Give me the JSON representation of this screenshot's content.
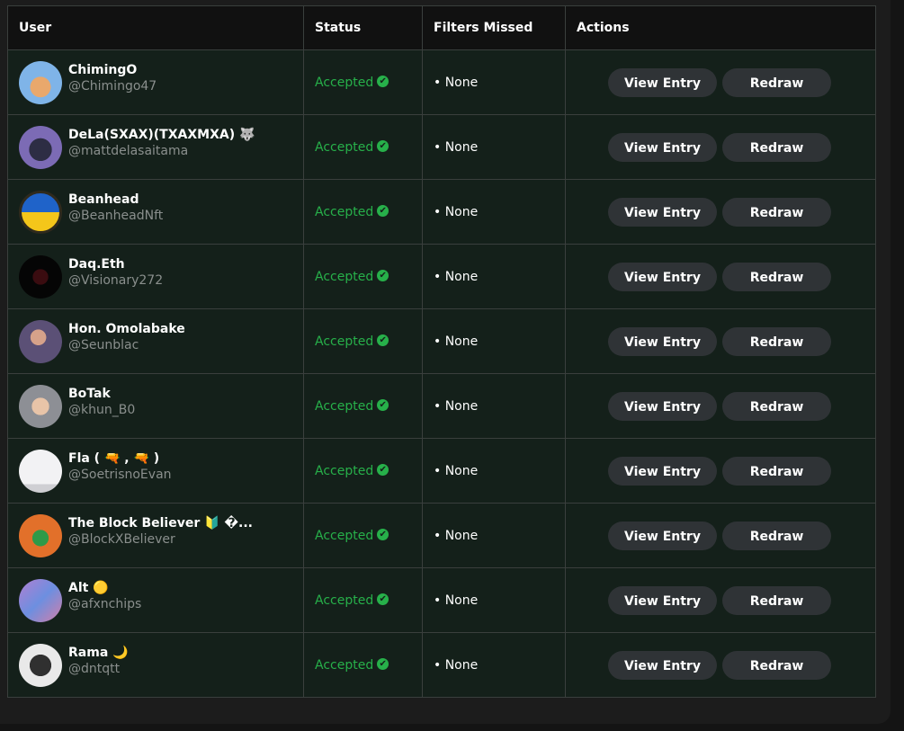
{
  "table": {
    "headers": {
      "user": "User",
      "status": "Status",
      "filters": "Filters Missed",
      "actions": "Actions"
    },
    "view_label": "View Entry",
    "redraw_label": "Redraw",
    "check_icon": "✔",
    "rows": [
      {
        "name": "ChimingO",
        "handle": "@Chimingo47",
        "status": "Accepted",
        "filters": "• None",
        "avatar_icon": "pixel-avatar"
      },
      {
        "name": "DeLa(SXAX)(TXAXMXA) 🐺",
        "handle": "@mattdelasaitama",
        "status": "Accepted",
        "filters": "• None",
        "avatar_icon": "bull-avatar"
      },
      {
        "name": "Beanhead",
        "handle": "@BeanheadNft",
        "status": "Accepted",
        "filters": "• None",
        "avatar_icon": "ukraine-flag-avatar"
      },
      {
        "name": "Daq.Eth",
        "handle": "@Visionary272",
        "status": "Accepted",
        "filters": "• None",
        "avatar_icon": "skull-avatar"
      },
      {
        "name": "Hon. Omolabake",
        "handle": "@Seunblac",
        "status": "Accepted",
        "filters": "• None",
        "avatar_icon": "photo-avatar"
      },
      {
        "name": "BoTak",
        "handle": "@khun_B0",
        "status": "Accepted",
        "filters": "• None",
        "avatar_icon": "punk-avatar"
      },
      {
        "name": "Fla ( 🔫 , 🔫 )",
        "handle": "@SoetrisnoEvan",
        "status": "Accepted",
        "filters": "• None",
        "avatar_icon": "landscape-avatar"
      },
      {
        "name": "The Block Believer 🔰 �...",
        "handle": "@BlockXBeliever",
        "status": "Accepted",
        "filters": "• None",
        "avatar_icon": "triangle-logo-avatar"
      },
      {
        "name": "Alt 🟡",
        "handle": "@afxnchips",
        "status": "Accepted",
        "filters": "• None",
        "avatar_icon": "art-avatar"
      },
      {
        "name": "Rama 🌙",
        "handle": "@dntqtt",
        "status": "Accepted",
        "filters": "• None",
        "avatar_icon": "silhouette-avatar"
      }
    ]
  }
}
